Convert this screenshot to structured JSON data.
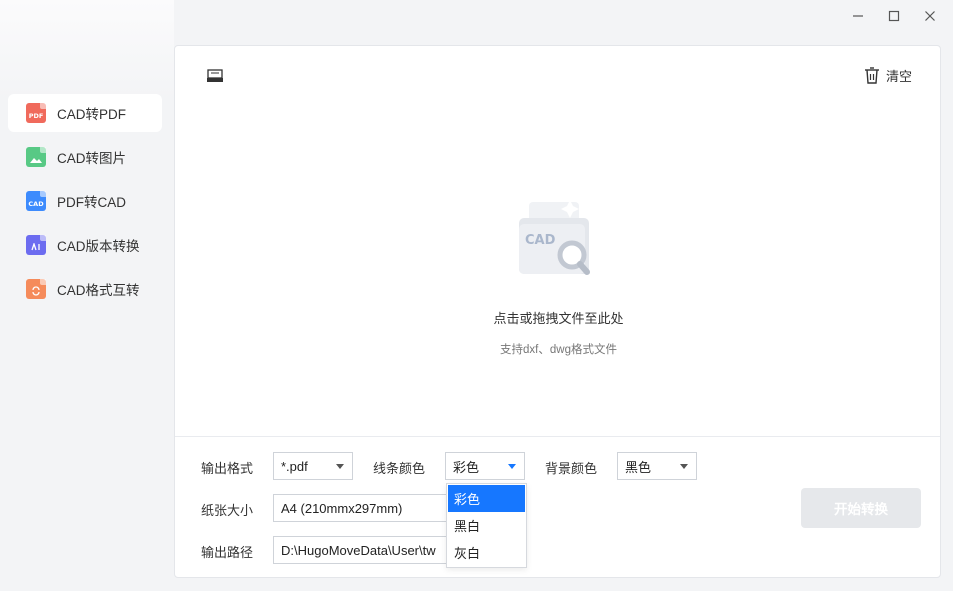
{
  "colors": {
    "accent": "#1677ff",
    "pdf": "#f06a5c",
    "image": "#58c985",
    "cad": "#3d8bfd",
    "version": "#6c6cf0",
    "format": "#f58b5b"
  },
  "sidebar": {
    "items": [
      {
        "label": "CAD转PDF",
        "icon": "pdf-file-icon",
        "tag": "PDF",
        "active": true
      },
      {
        "label": "CAD转图片",
        "icon": "image-file-icon",
        "tag": "",
        "active": false
      },
      {
        "label": "PDF转CAD",
        "icon": "cad-file-icon",
        "tag": "CAD",
        "active": false
      },
      {
        "label": "CAD版本转换",
        "icon": "version-file-icon",
        "tag": "",
        "active": false
      },
      {
        "label": "CAD格式互转",
        "icon": "format-file-icon",
        "tag": "",
        "active": false
      }
    ]
  },
  "toolbar": {
    "clear_label": "清空"
  },
  "drop": {
    "main_text": "点击或拖拽文件至此处",
    "sub_text": "支持dxf、dwg格式文件",
    "illustration_text": "CAD"
  },
  "settings": {
    "output_format_label": "输出格式",
    "output_format_value": "*.pdf",
    "line_color_label": "线条颜色",
    "line_color_value": "彩色",
    "bg_color_label": "背景颜色",
    "bg_color_value": "黑色",
    "paper_size_label": "纸张大小",
    "paper_size_value": "A4 (210mmx297mm)",
    "output_path_label": "输出路径",
    "output_path_value": "D:\\HugoMoveData\\User\\tw"
  },
  "line_color_options": [
    "彩色",
    "黑白",
    "灰白"
  ],
  "start_button": "开始转换"
}
